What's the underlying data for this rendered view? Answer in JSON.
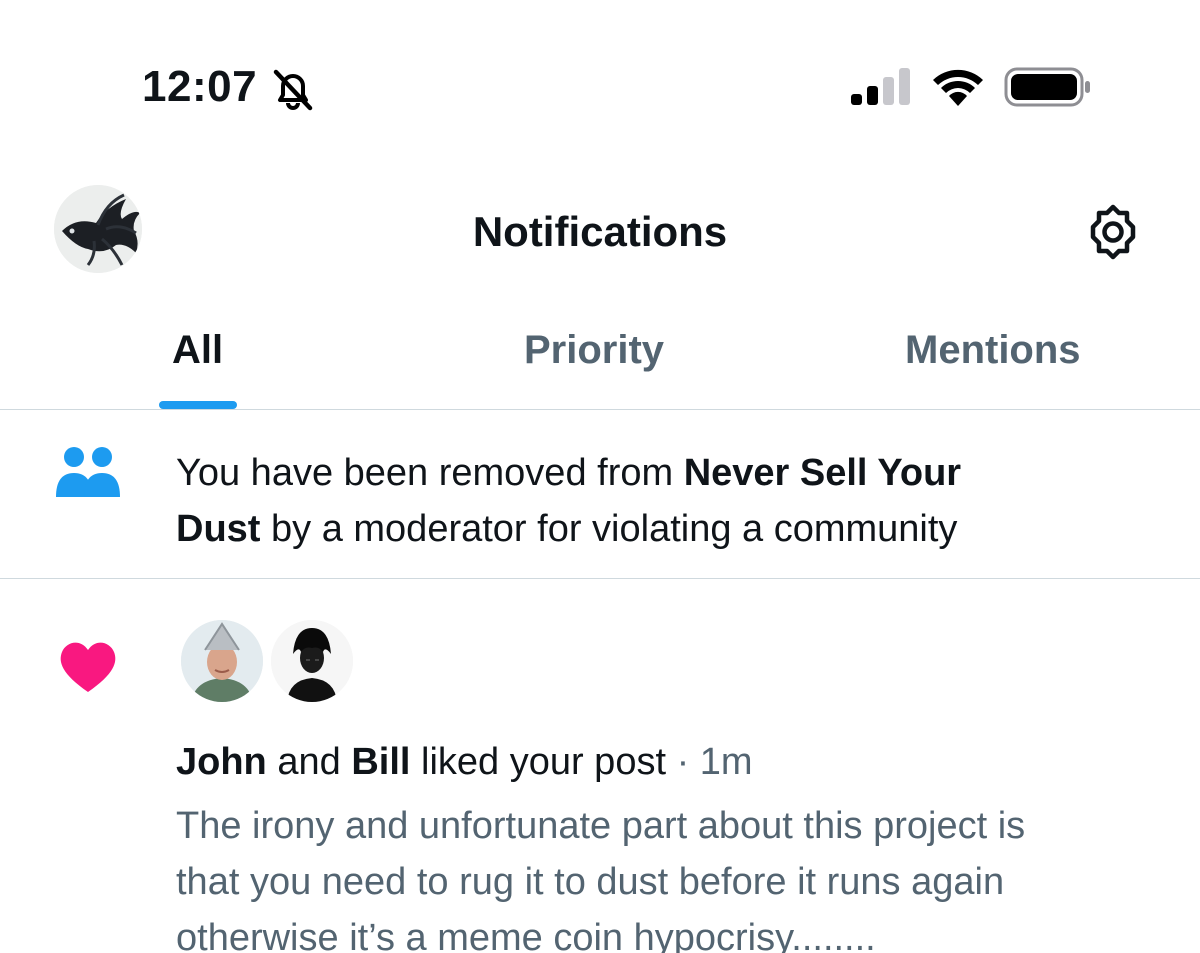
{
  "status_bar": {
    "time": "12:07",
    "icons": [
      "bell-slash-icon",
      "cellular-signal-icon",
      "wifi-icon",
      "battery-icon"
    ]
  },
  "header": {
    "title": "Notifications",
    "avatar_icon": "profile-avatar",
    "settings_icon": "gear-icon"
  },
  "tabs": [
    {
      "label": "All",
      "active": true
    },
    {
      "label": "Priority",
      "active": false
    },
    {
      "label": "Mentions",
      "active": false
    }
  ],
  "notifications": [
    {
      "type": "community",
      "icon": "community-icon",
      "text_prefix": "You have been removed from ",
      "community_name_line1": "Never Sell Your",
      "community_name_line2": "Dust",
      "text_suffix": " by a moderator for violating a community"
    },
    {
      "type": "like",
      "icon": "heart-icon",
      "user1": "John",
      "connector": " and ",
      "user2": "Bill",
      "action": " liked your post",
      "separator": " · ",
      "time": "1m",
      "post_line1": "The irony and unfortunate part about this project is",
      "post_line2": "that you need to rug it to dust before it runs again",
      "post_line3": "otherwise it’s a meme coin hypocrisy........"
    }
  ],
  "colors": {
    "accent": "#1d9bf0",
    "like": "#f91880",
    "secondary_text": "#536471",
    "divider": "#cfd9de"
  }
}
